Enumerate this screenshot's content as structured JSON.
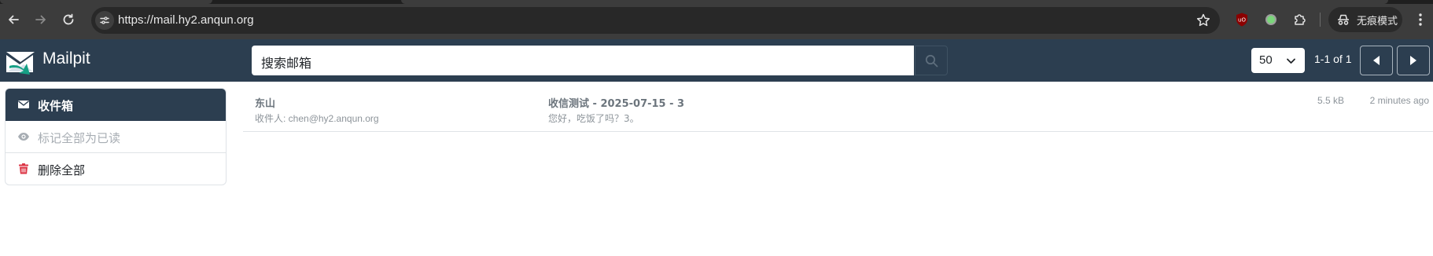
{
  "browser": {
    "url": "https://mail.hy2.anqun.org",
    "incognito_label": "无痕模式"
  },
  "header": {
    "brand": "Mailpit",
    "search_value": "搜索邮箱",
    "per_page": "50",
    "pager_text": "1-1 of 1"
  },
  "sidebar": {
    "items": [
      {
        "label": "收件箱",
        "icon": "envelope-icon"
      },
      {
        "label": "标记全部为已读",
        "icon": "eye-icon"
      },
      {
        "label": "删除全部",
        "icon": "trash-icon"
      }
    ]
  },
  "messages": [
    {
      "from": "东山",
      "to": "收件人: chen@hy2.anqun.org",
      "subject": "收信测试 - 2025-07-15 - 3",
      "snippet": "您好，吃饭了吗？3。",
      "size": "5.5 kB",
      "time": "2 minutes ago"
    }
  ],
  "colors": {
    "header_bg": "#2c3e50",
    "browser_bg": "#3c3c3c",
    "delete_icon": "#dc3545"
  }
}
